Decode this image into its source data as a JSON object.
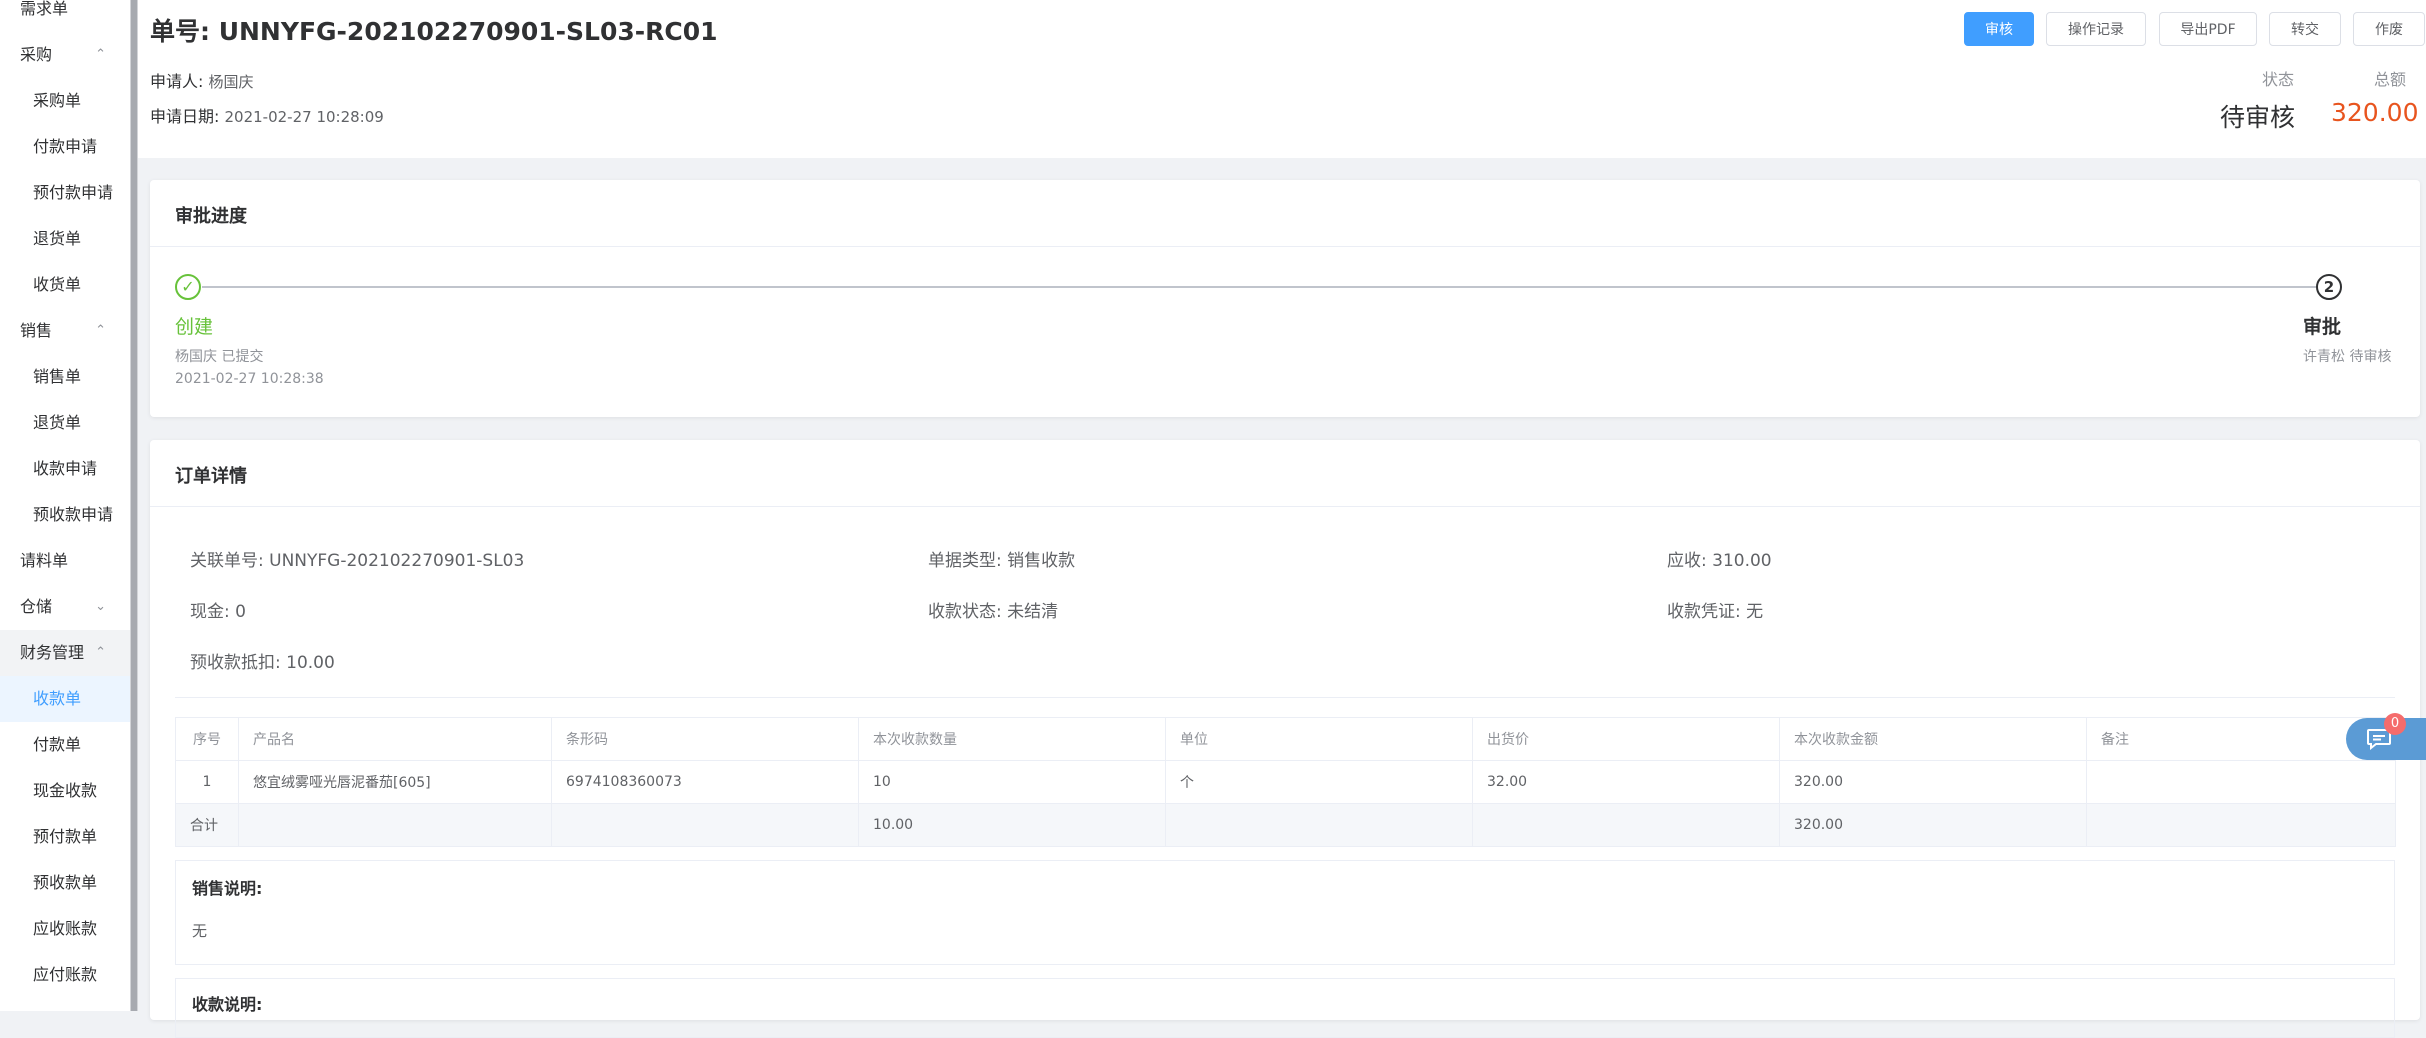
{
  "sidebar": {
    "items": [
      {
        "label": "需求单"
      },
      {
        "label": "采购",
        "chevron": "^"
      },
      {
        "label": "采购单"
      },
      {
        "label": "付款申请"
      },
      {
        "label": "预付款申请"
      },
      {
        "label": "退货单"
      },
      {
        "label": "收货单"
      },
      {
        "label": "销售",
        "chevron": "^"
      },
      {
        "label": "销售单"
      },
      {
        "label": "退货单"
      },
      {
        "label": "收款申请"
      },
      {
        "label": "预收款申请"
      },
      {
        "label": "请料单"
      },
      {
        "label": "仓储",
        "chevron": "v"
      },
      {
        "label": "财务管理",
        "chevron": "^"
      },
      {
        "label": "收款单"
      },
      {
        "label": "付款单"
      },
      {
        "label": "现金收款"
      },
      {
        "label": "预付款单"
      },
      {
        "label": "预收款单"
      },
      {
        "label": "应收账款"
      },
      {
        "label": "应付账款"
      }
    ]
  },
  "header": {
    "order_label": "单号: UNNYFG-202102270901-SL03-RC01",
    "applicant_label": "申请人:",
    "applicant": "杨国庆",
    "date_label": "申请日期:",
    "date": "2021-02-27 10:28:09",
    "buttons": {
      "review": "审核",
      "log": "操作记录",
      "export": "导出PDF",
      "transfer": "转交",
      "void": "作废"
    },
    "status_label": "状态",
    "status": "待审核",
    "total_label": "总额",
    "total": "320.00"
  },
  "progress": {
    "title": "审批进度",
    "steps": [
      {
        "title": "创建",
        "desc1": "杨国庆 已提交",
        "desc2": "2021-02-27 10:28:38",
        "number": ""
      },
      {
        "title": "审批",
        "desc1": "许青松 待审核",
        "desc2": "",
        "number": "2"
      }
    ]
  },
  "details": {
    "title": "订单详情",
    "related": "关联单号: UNNYFG-202102270901-SL03",
    "doc_type": "单据类型: 销售收款",
    "receivable": "应收: 310.00",
    "cash": "现金: 0",
    "receipt_status": "收款状态: 未结清",
    "voucher": "收款凭证:  无",
    "prepay_deduct": "预收款抵扣: 10.00",
    "table": {
      "headers": [
        "序号",
        "产品名",
        "条形码",
        "本次收款数量",
        "单位",
        "出货价",
        "本次收款金额",
        "备注"
      ],
      "rows": [
        [
          "1",
          "悠宜绒雾哑光唇泥番茄[605]",
          "6974108360073",
          "10",
          "个",
          "32.00",
          "320.00",
          ""
        ]
      ],
      "summary": [
        "合计",
        "",
        "",
        "10.00",
        "",
        "",
        "320.00",
        ""
      ]
    },
    "sales_note_title": "销售说明:",
    "sales_note": "无",
    "receipt_note_title": "收款说明:"
  },
  "chat": {
    "badge": "0",
    "icon": "chat-icon"
  }
}
